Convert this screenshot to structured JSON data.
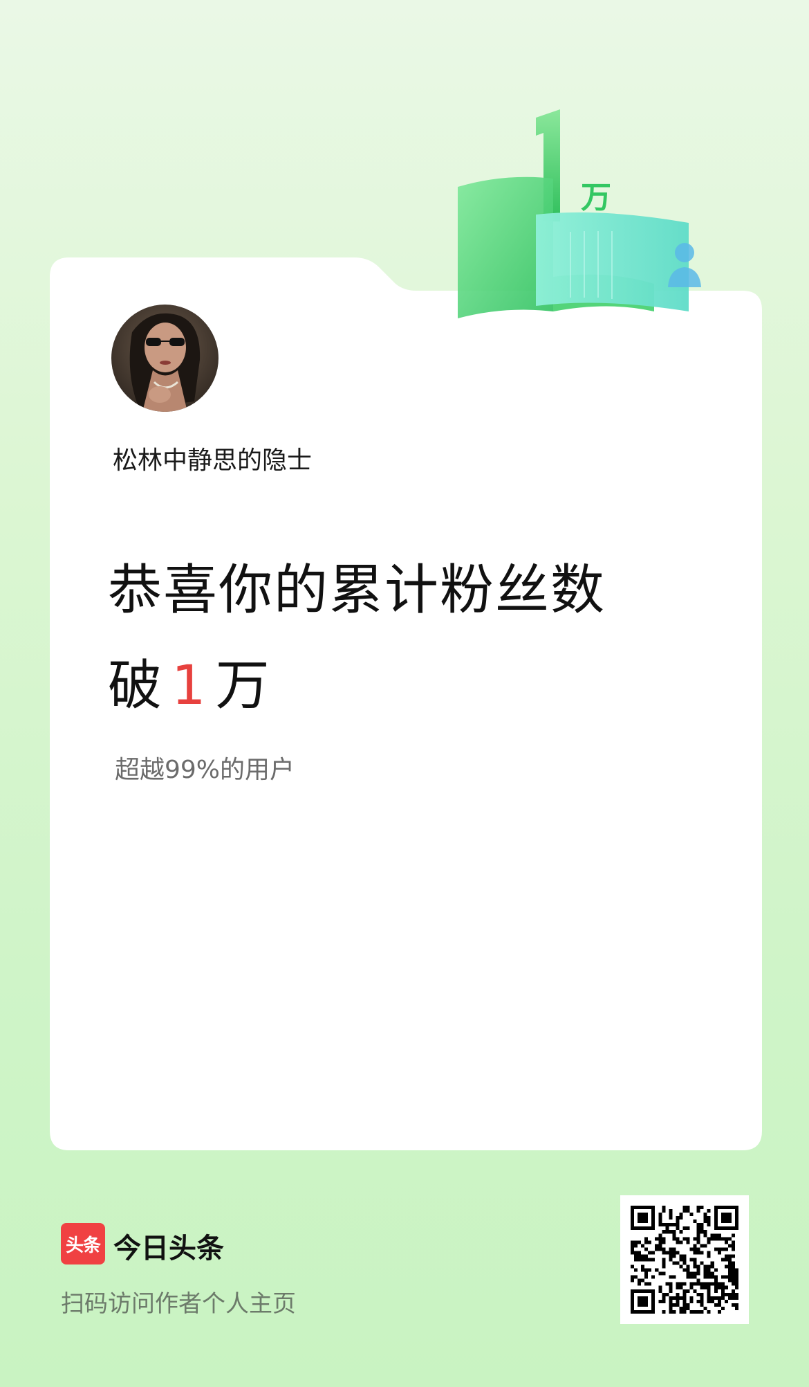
{
  "profile": {
    "username": "松林中静思的隐士"
  },
  "milestone": {
    "headline_line1": "恭喜你的累计粉丝数",
    "prefix": "破",
    "number": "1",
    "unit": "万",
    "subtext": "超越99%的用户",
    "badge_number": "1",
    "badge_unit": "万"
  },
  "footer": {
    "logo_text": "头条",
    "brand_name": "今日头条",
    "caption": "扫码访问作者个人主页"
  },
  "colors": {
    "accent_red": "#e7413e",
    "brand_red": "#f04142",
    "badge_green": "#3ccf68"
  },
  "icons": {
    "qr": "qr-code-icon",
    "user": "user-icon"
  }
}
